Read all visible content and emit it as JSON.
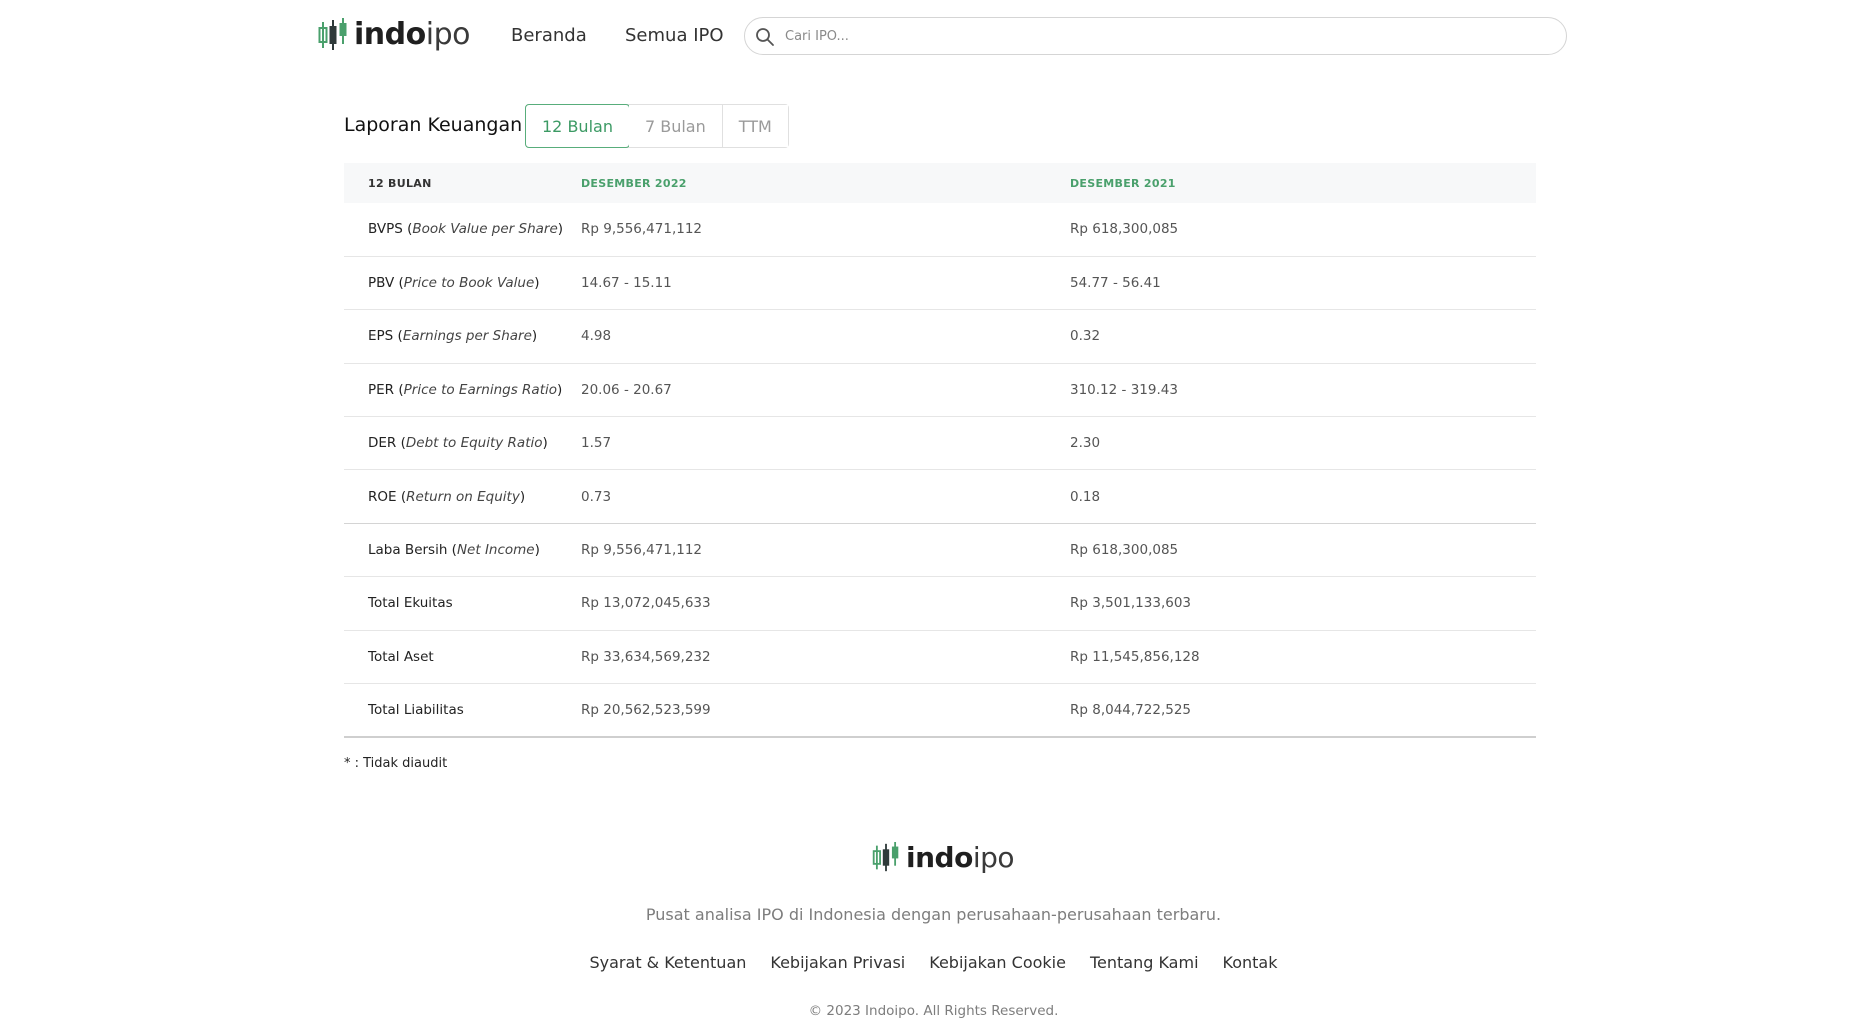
{
  "brand": {
    "name_part1": "indo",
    "name_part2": "ipo",
    "green": "#4aa06c"
  },
  "header": {
    "nav": [
      {
        "label": "Beranda"
      },
      {
        "label": "Semua IPO"
      }
    ],
    "search": {
      "placeholder": "Cari IPO..."
    }
  },
  "financials": {
    "title": "Laporan Keuangan",
    "tabs": [
      {
        "label": "12 Bulan",
        "active": true
      },
      {
        "label": "7 Bulan",
        "active": false
      },
      {
        "label": "TTM",
        "active": false
      }
    ],
    "columns": [
      "12 BULAN",
      "DESEMBER 2022",
      "DESEMBER 2021"
    ],
    "rows": [
      {
        "abbr": "BVPS",
        "full": "Book Value per Share",
        "v2022": "Rp 9,556,471,112",
        "v2021": "Rp 618,300,085"
      },
      {
        "abbr": "PBV",
        "full": "Price to Book Value",
        "v2022": "14.67 - 15.11",
        "v2021": "54.77 - 56.41"
      },
      {
        "abbr": "EPS",
        "full": "Earnings per Share",
        "v2022": "4.98",
        "v2021": "0.32"
      },
      {
        "abbr": "PER",
        "full": "Price to Earnings Ratio",
        "v2022": "20.06 - 20.67",
        "v2021": "310.12 - 319.43"
      },
      {
        "abbr": "DER",
        "full": "Debt to Equity Ratio",
        "v2022": "1.57",
        "v2021": "2.30"
      },
      {
        "abbr": "ROE",
        "full": "Return on Equity",
        "v2022": "0.73",
        "v2021": "0.18"
      },
      {
        "abbr": "Laba Bersih",
        "full": "Net Income",
        "v2022": "Rp 9,556,471,112",
        "v2021": "Rp 618,300,085"
      },
      {
        "abbr": "Total Ekuitas",
        "full": "",
        "v2022": "Rp 13,072,045,633",
        "v2021": "Rp 3,501,133,603"
      },
      {
        "abbr": "Total Aset",
        "full": "",
        "v2022": "Rp 33,634,569,232",
        "v2021": "Rp 11,545,856,128"
      },
      {
        "abbr": "Total Liabilitas",
        "full": "",
        "v2022": "Rp 20,562,523,599",
        "v2021": "Rp 8,044,722,525"
      }
    ],
    "footnote": "* : Tidak diaudit"
  },
  "footer": {
    "tagline": "Pusat analisa IPO di Indonesia dengan perusahaan-perusahaan terbaru.",
    "links": [
      {
        "label": "Syarat & Ketentuan"
      },
      {
        "label": "Kebijakan Privasi"
      },
      {
        "label": "Kebijakan Cookie"
      },
      {
        "label": "Tentang Kami"
      },
      {
        "label": "Kontak"
      }
    ],
    "copyright": "© 2023 Indoipo. All Rights Reserved."
  }
}
